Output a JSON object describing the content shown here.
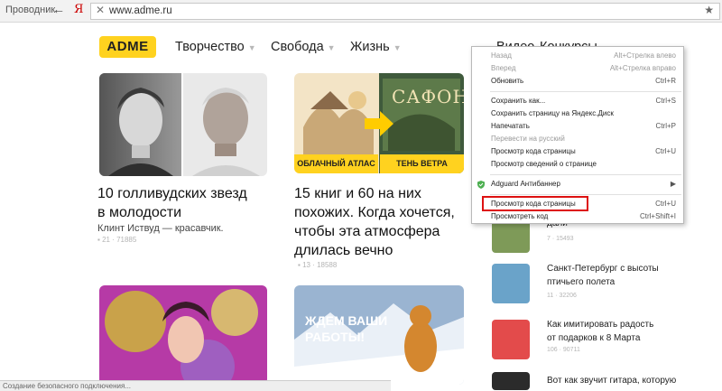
{
  "browser": {
    "explorer_label": "Проводник",
    "back_icon": "←",
    "yandex_icon": "Я",
    "url": "www.adme.ru",
    "close_icon": "✕",
    "star_icon": "★"
  },
  "site": {
    "logo": "ADME",
    "nav": [
      "Творчество",
      "Свобода",
      "Жизнь"
    ],
    "nav_right": [
      "Видео",
      "Конкурсы"
    ],
    "accent": "#ffd21f"
  },
  "articles": [
    {
      "title_line1": "10 голливудских звезд",
      "title_line2": "в молодости",
      "subtitle": "Клинт Иствуд — красавчик.",
      "meta": "21 · 71885"
    },
    {
      "title_line1": "15 книг и 60 на них",
      "title_line2": "похожих. Когда хочется,",
      "title_line3": "чтобы эта атмосфера",
      "title_line4": "длилась вечно",
      "meta": "13 · 18588",
      "badge_left": "ОБЛАЧНЫЙ АТЛАС",
      "badge_right": "ТЕНЬ ВЕТРА",
      "book_title": "САФОН"
    },
    {},
    {
      "overlay_line1": "ЖДЕМ ВАШИ",
      "overlay_line2": "РАБОТЫ!"
    }
  ],
  "sidebar": [
    {
      "title_line1": "",
      "title_line2": "дали",
      "meta": "7 · 15493"
    },
    {
      "title_line1": "Санкт-Петербург с высоты",
      "title_line2": "птичьего полета",
      "meta": "11 · 32206"
    },
    {
      "title_line1": "Как имитировать радость",
      "title_line2": "от подарков к 8 Марта",
      "meta": "106 · 90711"
    },
    {
      "title_line1": "Вот как звучит гитара, которую",
      "title_line2": ""
    }
  ],
  "context_menu": {
    "items": [
      {
        "label": "Назад",
        "shortcut": "Alt+Стрелка влево",
        "disabled": true
      },
      {
        "label": "Вперед",
        "shortcut": "Alt+Стрелка вправо",
        "disabled": true
      },
      {
        "label": "Обновить",
        "shortcut": "Ctrl+R",
        "disabled": false
      },
      {
        "label": "Сохранить как...",
        "shortcut": "Ctrl+S",
        "disabled": false
      },
      {
        "label": "Сохранить страницу на Яндекс.Диск",
        "shortcut": "",
        "disabled": false
      },
      {
        "label": "Напечатать",
        "shortcut": "Ctrl+P",
        "disabled": false
      },
      {
        "label": "Перевести на русский",
        "shortcut": "",
        "disabled": true
      },
      {
        "label": "Просмотр кода страницы",
        "shortcut": "Ctrl+U",
        "disabled": false
      },
      {
        "label": "Просмотр сведений о странице",
        "shortcut": "",
        "disabled": false
      },
      {
        "label": "Adguard Антибаннер",
        "shortcut": "▶",
        "disabled": false
      },
      {
        "label": "Просмотр кода страницы",
        "shortcut": "Ctrl+U",
        "disabled": false
      },
      {
        "label": "Просмотреть код",
        "shortcut": "Ctrl+Shift+I",
        "disabled": false
      }
    ]
  },
  "status": "Создание безопасного подключения..."
}
